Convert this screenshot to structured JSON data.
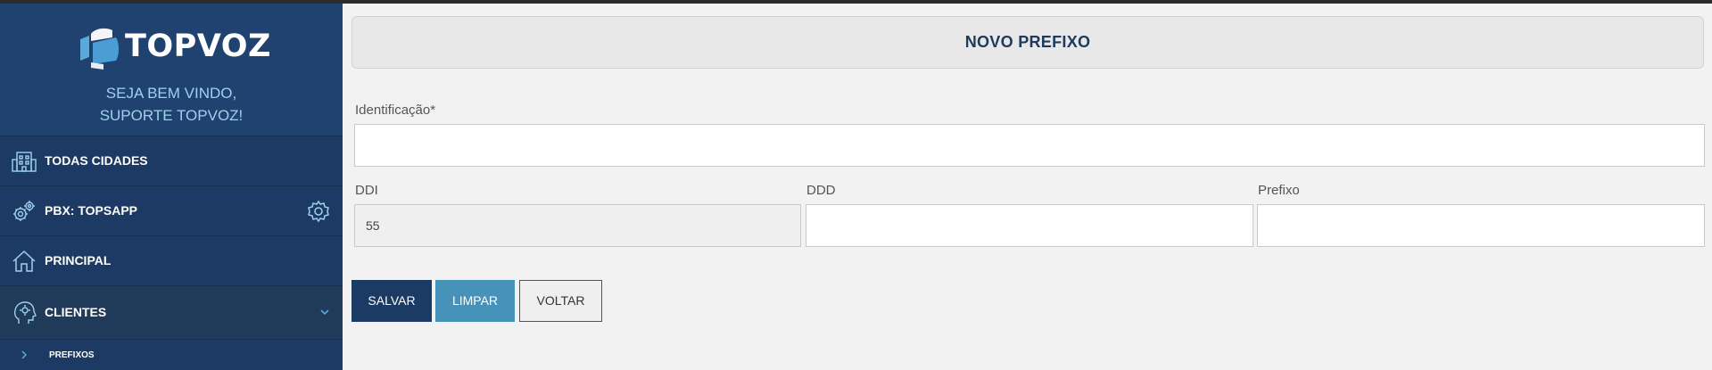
{
  "brand": {
    "logo_text": "TOPVOZ"
  },
  "welcome": {
    "line1": "SEJA BEM VINDO,",
    "line2": "SUPORTE TOPVOZ!"
  },
  "sidebar": {
    "items": [
      {
        "label": "TODAS CIDADES",
        "icon": "building-icon"
      },
      {
        "label": "PBX: TOPSAPP",
        "icon": "gears-icon",
        "trailing_icon": "gear-icon"
      },
      {
        "label": "PRINCIPAL",
        "icon": "home-icon"
      },
      {
        "label": "CLIENTES",
        "icon": "head-gear-icon",
        "expanded": true
      }
    ],
    "sub_items": [
      {
        "label": "PREFIXOS"
      }
    ]
  },
  "page": {
    "title": "NOVO PREFIXO"
  },
  "form": {
    "identificacao": {
      "label": "Identificação*",
      "value": ""
    },
    "ddi": {
      "label": "DDI",
      "value": "55"
    },
    "ddd": {
      "label": "DDD",
      "value": ""
    },
    "prefixo": {
      "label": "Prefixo",
      "value": ""
    }
  },
  "buttons": {
    "save": "SALVAR",
    "clear": "LIMPAR",
    "back": "VOLTAR"
  },
  "colors": {
    "sidebar": "#1c3a63",
    "brand_bg": "#1f4271",
    "accent_light": "#9fd1ec",
    "primary": "#1b3a64",
    "secondary": "#4792b8"
  }
}
